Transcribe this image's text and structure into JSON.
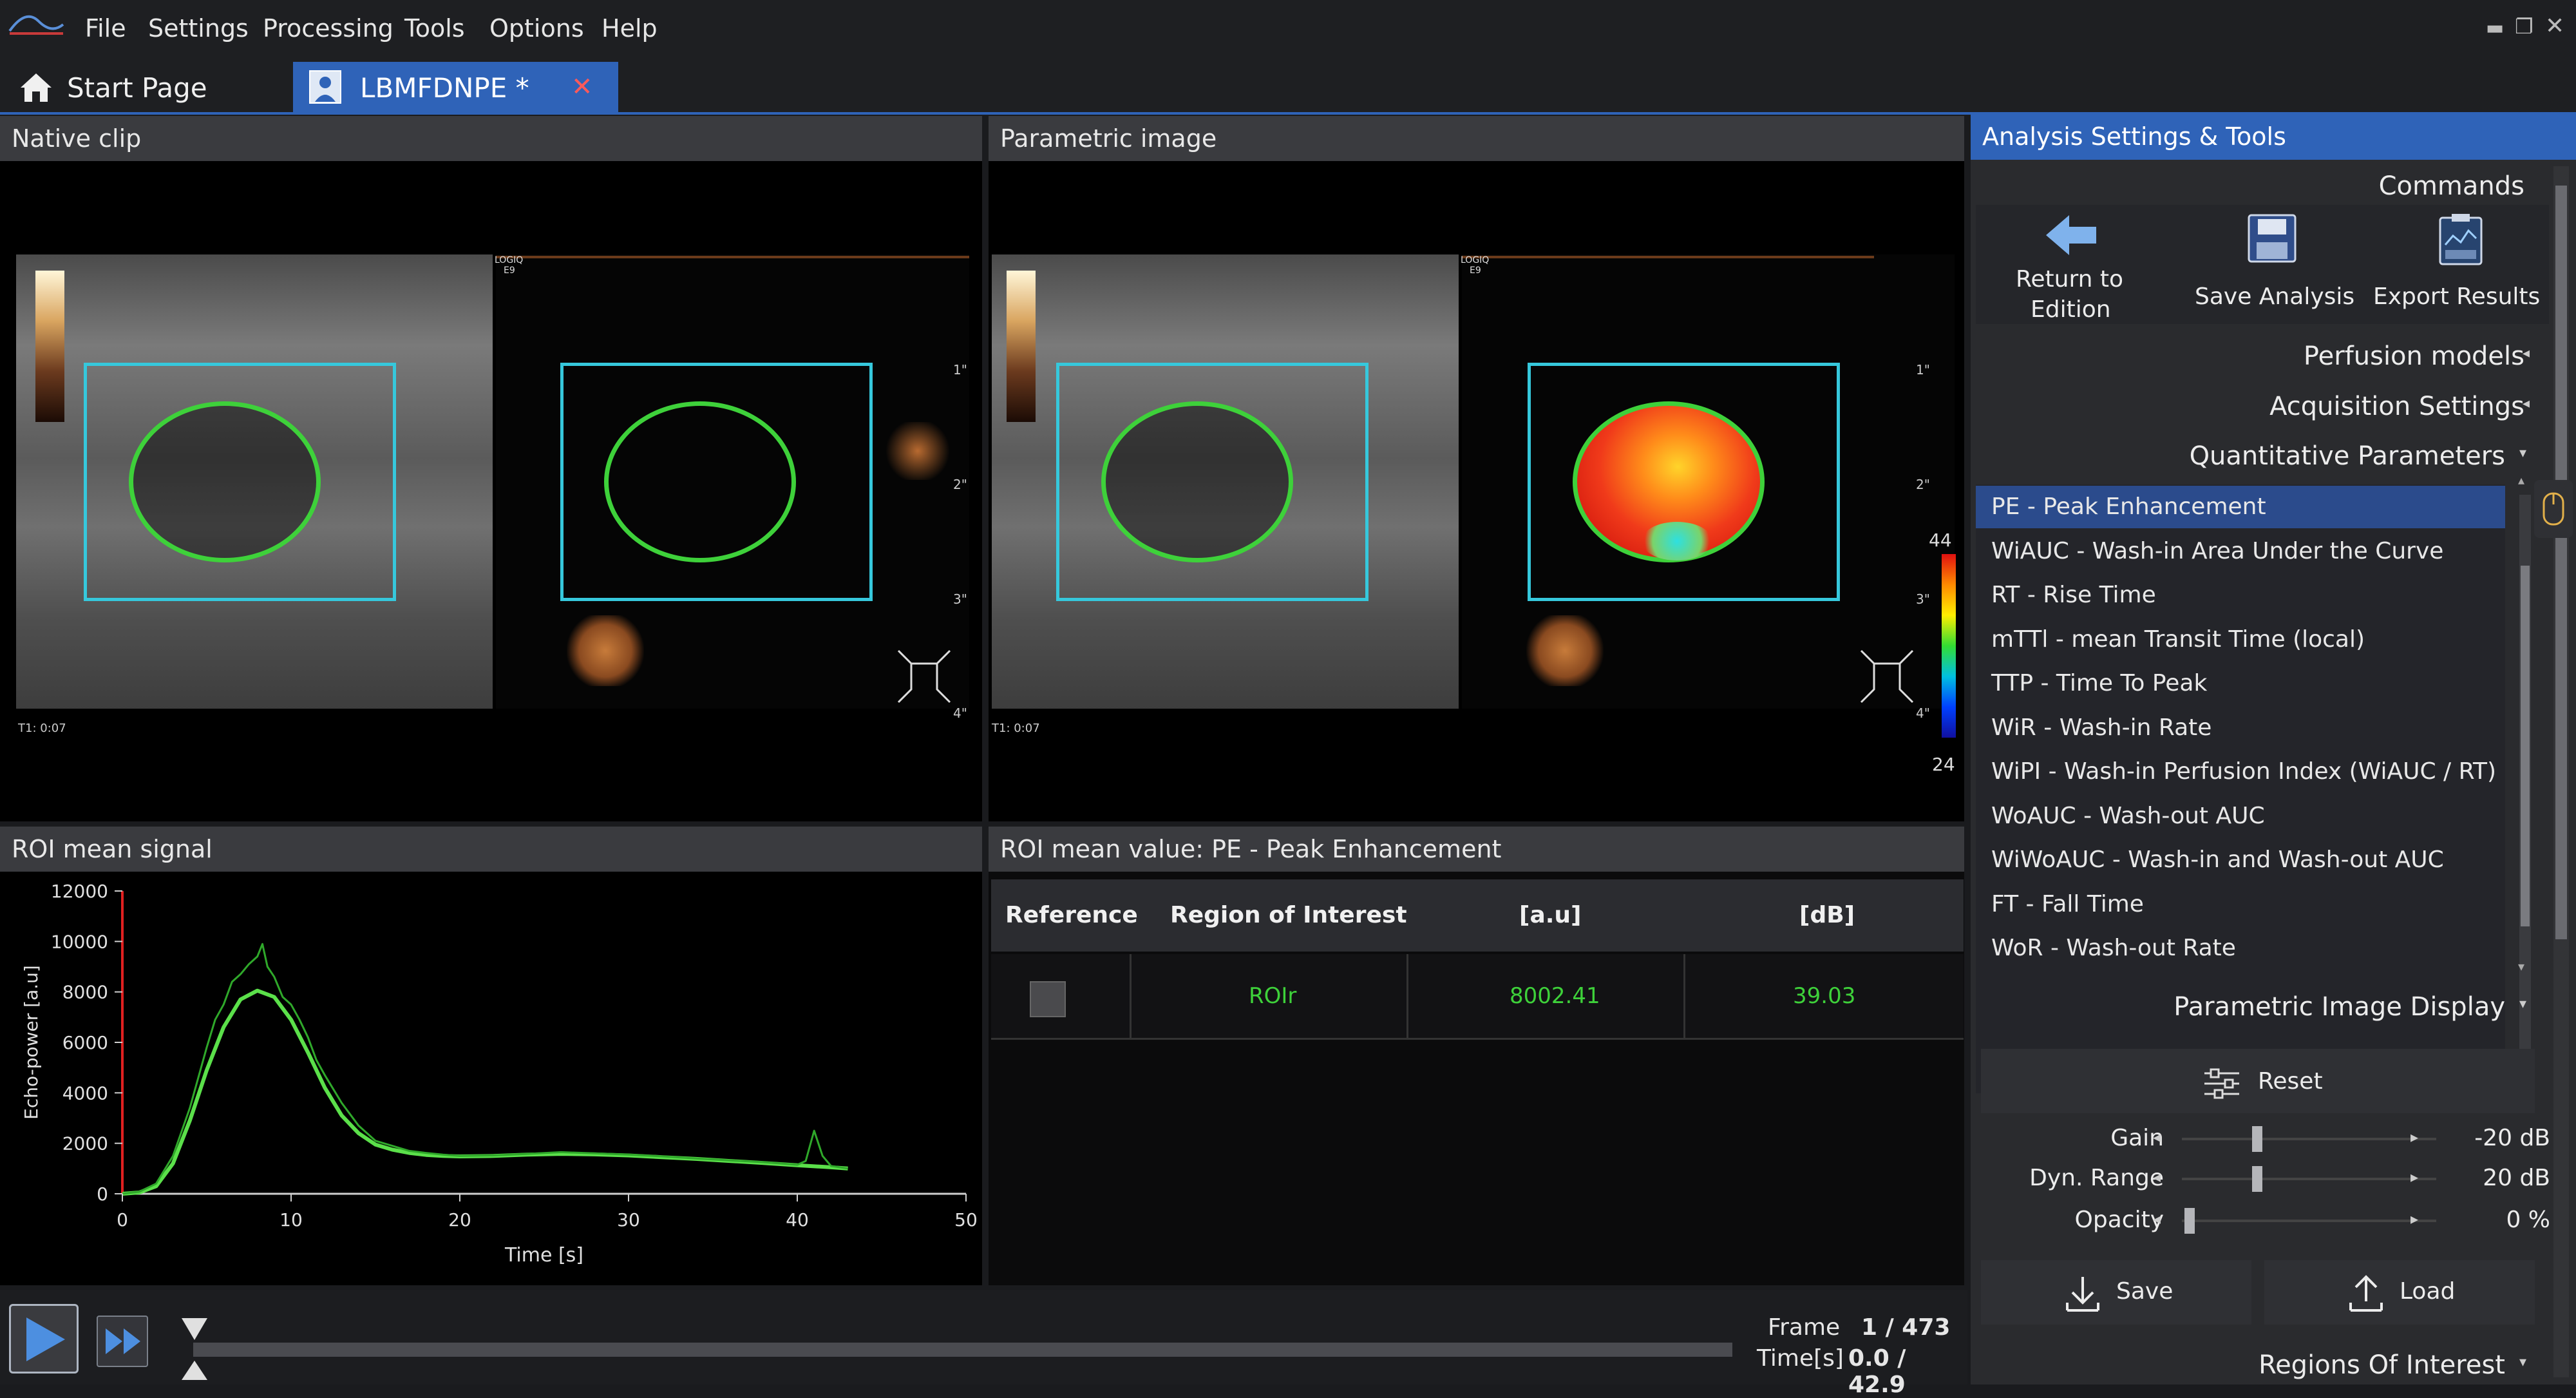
{
  "menu": {
    "file": "File",
    "settings": "Settings",
    "processing": "Processing",
    "tools": "Tools",
    "options": "Options",
    "help": "Help"
  },
  "tabs": {
    "start": "Start Page",
    "study": "LBMFDNPE *"
  },
  "panels": {
    "native": "Native clip",
    "parametric": "Parametric image",
    "roi_signal": "ROI mean signal",
    "roi_value": "ROI mean value: PE - Peak Enhancement"
  },
  "overlay": {
    "logiq": "LOGIQ",
    "e9": "E9",
    "t1": "T1: 0:07",
    "d1": "1\"",
    "d2": "2\"",
    "d3": "3\"",
    "d4": "4\"",
    "scale_max": "44",
    "scale_min": "24"
  },
  "table": {
    "headers": [
      "Reference",
      "Region of Interest",
      "[a.u]",
      "[dB]"
    ],
    "row": {
      "roi": "ROIr",
      "au": "8002.41",
      "db": "39.03"
    }
  },
  "chart_data": {
    "type": "line",
    "xlabel": "Time [s]",
    "ylabel": "Echo-power [a.u]",
    "xlim": [
      0,
      50
    ],
    "ylim": [
      0,
      12000
    ],
    "xticks": [
      0,
      10,
      20,
      30,
      40,
      50
    ],
    "yticks": [
      0,
      2000,
      4000,
      6000,
      8000,
      10000,
      12000
    ],
    "series": [
      {
        "x": [
          0,
          1,
          2,
          3,
          4,
          5,
          6,
          7,
          8,
          9,
          10,
          11,
          12,
          13,
          14,
          15,
          16,
          17,
          18,
          19,
          20,
          22,
          24,
          26,
          28,
          30,
          32,
          34,
          36,
          38,
          40,
          42,
          43
        ],
        "y": [
          0,
          50,
          300,
          1200,
          2900,
          4900,
          6600,
          7700,
          8050,
          7800,
          6900,
          5600,
          4200,
          3100,
          2400,
          1950,
          1750,
          1620,
          1540,
          1500,
          1480,
          1500,
          1550,
          1580,
          1560,
          1520,
          1450,
          1380,
          1300,
          1220,
          1130,
          1050,
          1000
        ]
      },
      {
        "x": [
          0,
          1,
          2,
          3,
          4,
          5,
          5.5,
          6,
          6.5,
          7,
          7.5,
          8,
          8.3,
          8.6,
          9,
          9.5,
          10,
          10.5,
          11,
          11.5,
          12,
          13,
          14,
          15,
          16,
          17,
          18,
          19,
          20,
          22,
          24,
          26,
          28,
          30,
          32,
          34,
          36,
          38,
          40,
          40.5,
          41,
          41.5,
          42,
          43
        ],
        "y": [
          0,
          80,
          400,
          1500,
          3400,
          5800,
          6900,
          7500,
          8400,
          8700,
          9100,
          9400,
          9900,
          9000,
          8600,
          7800,
          7500,
          6900,
          6200,
          5300,
          4700,
          3600,
          2700,
          2100,
          1900,
          1700,
          1620,
          1550,
          1500,
          1520,
          1580,
          1650,
          1600,
          1550,
          1480,
          1400,
          1320,
          1250,
          1150,
          1300,
          2500,
          1500,
          1100,
          1000
        ]
      }
    ]
  },
  "right": {
    "title": "Analysis Settings & Tools",
    "commands": "Commands",
    "return_line1": "Return to",
    "return_line2": "Edition",
    "save_analysis": "Save Analysis",
    "export_results": "Export Results",
    "perfusion": "Perfusion models",
    "acquisition": "Acquisition Settings",
    "quantitative": "Quantitative Parameters",
    "params": [
      "PE - Peak Enhancement",
      "WiAUC - Wash-in Area Under the Curve",
      "RT - Rise Time",
      "mTTl - mean Transit Time (local)",
      "TTP - Time To Peak",
      "WiR - Wash-in Rate",
      "WiPI - Wash-in Perfusion Index (WiAUC / RT)",
      "WoAUC - Wash-out AUC",
      "WiWoAUC - Wash-in and Wash-out AUC",
      "FT - Fall Time",
      "WoR - Wash-out Rate"
    ],
    "display": "Parametric Image Display",
    "reset": "Reset",
    "gain_label": "Gain",
    "gain_value": "-20 dB",
    "dyn_label": "Dyn. Range",
    "dyn_value": "20 dB",
    "opacity_label": "Opacity",
    "opacity_value": "0 %",
    "save": "Save",
    "load": "Load",
    "regions": "Regions Of Interest"
  },
  "playback": {
    "frame_label": "Frame",
    "frame_value": "1 / 473",
    "time_label": "Time[s]",
    "time_value": "0.0 / 42.9"
  },
  "colors": {
    "accent": "#2f63b8",
    "roi_green": "#3ed13a",
    "roi_cyan": "#36c8dc",
    "selected": "#2b4b8c"
  }
}
